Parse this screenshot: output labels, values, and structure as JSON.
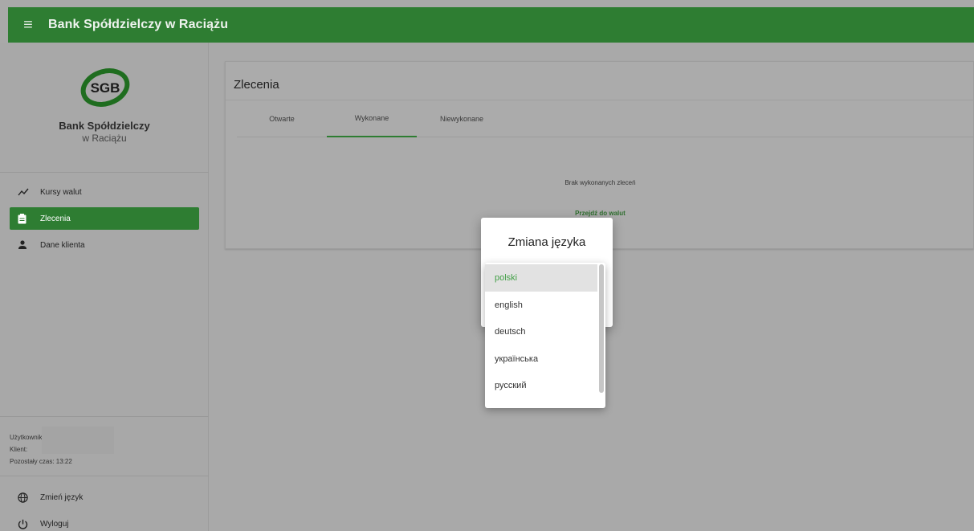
{
  "app": {
    "title": "Bank Spółdzielczy w Raciążu"
  },
  "logo": {
    "mark": "SGB",
    "line1": "Bank Spółdzielczy",
    "line2": "w Raciążu",
    "brand_color": "#2e7d32"
  },
  "sidebar": {
    "items": [
      {
        "label": "Kursy walut",
        "icon": "chart-line-icon",
        "active": false
      },
      {
        "label": "Zlecenia",
        "icon": "clipboard-icon",
        "active": true
      },
      {
        "label": "Dane klienta",
        "icon": "person-icon",
        "active": false
      }
    ],
    "user_label": "Użytkownik:",
    "client_label": "Klient:",
    "time_left": "Pozostały czas: 13:22",
    "bottom_items": [
      {
        "label": "Zmień język",
        "icon": "globe-icon"
      },
      {
        "label": "Wyloguj",
        "icon": "power-icon"
      }
    ]
  },
  "main": {
    "title": "Zlecenia",
    "tabs": [
      {
        "label": "Otwarte",
        "active": false
      },
      {
        "label": "Wykonane",
        "active": true
      },
      {
        "label": "Niewykonane",
        "active": false
      }
    ],
    "empty_message": "Brak wykonanych zleceń",
    "empty_link": "Przejdź do walut"
  },
  "dialog": {
    "title": "Zmiana języka",
    "options": [
      "polski",
      "english",
      "deutsch",
      "українська",
      "русский"
    ],
    "selected": "polski"
  },
  "colors": {
    "accent": "#2e7d32",
    "selected_text": "#43a047",
    "overlay": "#a9a9a9"
  }
}
